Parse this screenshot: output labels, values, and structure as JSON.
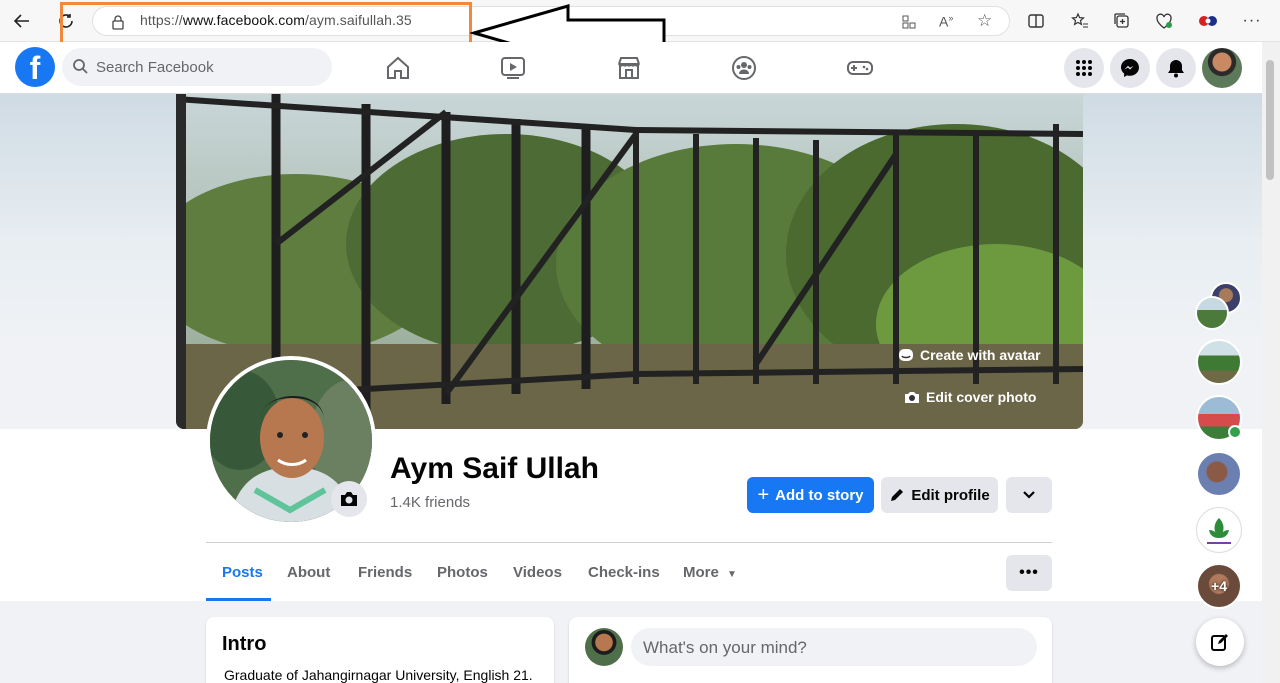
{
  "browser": {
    "url_prefix": "https://",
    "url_domain": "www.facebook.com",
    "url_path": "/aym.saifullah.35"
  },
  "nav": {
    "search_placeholder": "Search Facebook",
    "icons": [
      "home-icon",
      "watch-icon",
      "marketplace-icon",
      "groups-icon",
      "gaming-icon"
    ],
    "brand_color": "#1877f2"
  },
  "cover": {
    "create_avatar_label": "Create with avatar",
    "edit_cover_label": "Edit cover photo"
  },
  "profile": {
    "name": "Aym Saif Ullah",
    "friends": "1.4K friends",
    "add_story_label": "Add to story",
    "edit_profile_label": "Edit profile"
  },
  "tabs": [
    {
      "label": "Posts",
      "active": true
    },
    {
      "label": "About"
    },
    {
      "label": "Friends"
    },
    {
      "label": "Photos"
    },
    {
      "label": "Videos"
    },
    {
      "label": "Check-ins"
    },
    {
      "label": "More"
    }
  ],
  "intro": {
    "title": "Intro",
    "text": "Graduate of Jahangirnagar University, English 21."
  },
  "composer": {
    "placeholder": "What's on your mind?"
  },
  "contacts": {
    "more_count": "+4"
  }
}
